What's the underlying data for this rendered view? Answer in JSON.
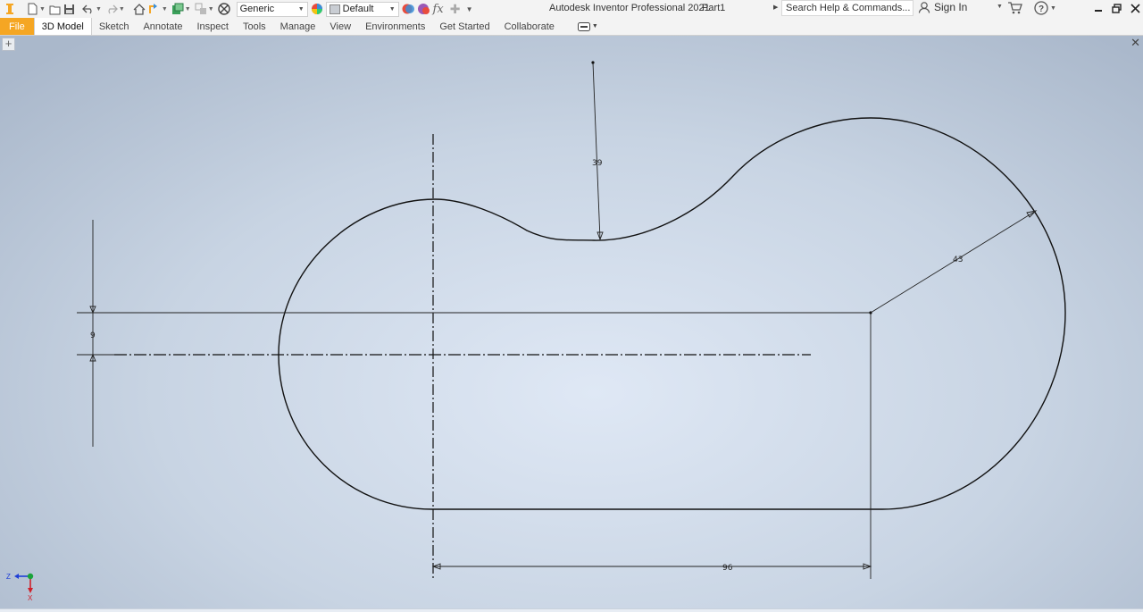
{
  "app": {
    "title": "Autodesk Inventor Professional 2021",
    "document": "Part1"
  },
  "quick_access": {
    "material_combo": "Generic",
    "appearance_combo": "Default",
    "icons": [
      "inventor-logo-icon",
      "new-icon",
      "open-icon",
      "save-icon",
      "undo-icon",
      "redo-icon",
      "home-icon",
      "return-icon",
      "update-icon",
      "select-icon",
      "measure-icon",
      "material-icon",
      "appearance-icon",
      "adjust-icon",
      "clear-icon",
      "parameters-icon",
      "add-icon",
      "customize-icon"
    ]
  },
  "search": {
    "placeholder": "Search Help & Commands..."
  },
  "account": {
    "sign_in": "Sign In"
  },
  "ribbon": {
    "tabs": [
      {
        "label": "File"
      },
      {
        "label": "3D Model"
      },
      {
        "label": "Sketch"
      },
      {
        "label": "Annotate"
      },
      {
        "label": "Inspect"
      },
      {
        "label": "Tools"
      },
      {
        "label": "Manage"
      },
      {
        "label": "View"
      },
      {
        "label": "Environments"
      },
      {
        "label": "Get Started"
      },
      {
        "label": "Collaborate"
      }
    ],
    "active_tab": "3D Model"
  },
  "sketch": {
    "dimensions": {
      "top_radius": "39",
      "right_radius": "43",
      "offset": "9",
      "length": "96"
    }
  },
  "viewcube_axes": {
    "z": "Z",
    "x": "X"
  },
  "colors": {
    "file_tab": "#f5a623",
    "canvas_center": "#dfe8f5",
    "canvas_edge": "#aab8cb",
    "sketch_line": "#111111",
    "axis_y": "#1aa33a",
    "axis_x": "#d0202a",
    "axis_z": "#1f3fd6"
  }
}
